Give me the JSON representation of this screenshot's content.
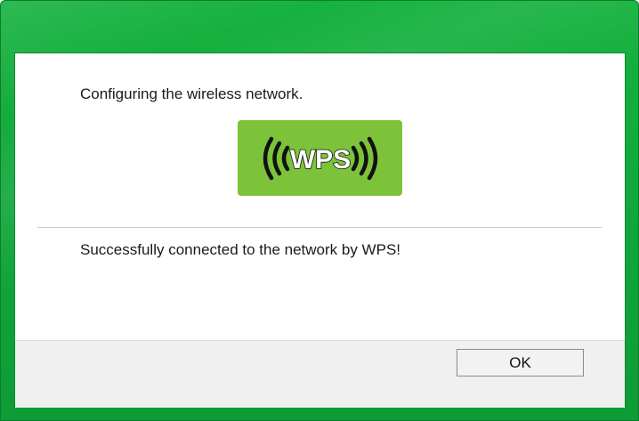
{
  "dialog": {
    "status_message": "Configuring the wireless network.",
    "result_message": "Successfully connected to the network by WPS!",
    "wps_logo_text": "WPS",
    "wps_icon": "wps-icon"
  },
  "footer": {
    "ok_label": "OK"
  },
  "colors": {
    "frame_green": "#0ea13a",
    "wps_badge_green": "#7cc33a"
  }
}
